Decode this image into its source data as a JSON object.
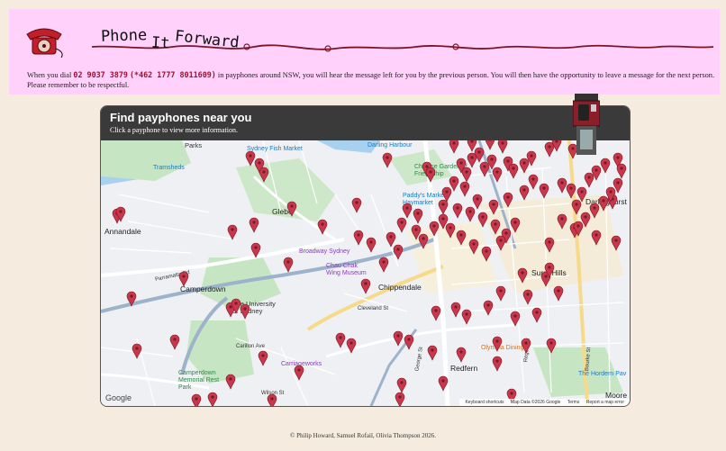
{
  "header": {
    "title_words": [
      "Phone",
      "It",
      "Forward"
    ],
    "intro_before": "When you dial ",
    "number_primary": "02 9037 3879",
    "number_alt": "(*462 1777 8011609)",
    "intro_after": " in payphones around NSW, you will hear the message left for you by the previous person. You will then have the opportunity to leave a message for the next person. Please remember to be respectful.",
    "logo_icon": "rotary-phone-icon"
  },
  "map": {
    "title": "Find payphones near you",
    "subtitle": "Click a payphone to view more information.",
    "header_image_icon": "payphone-icon",
    "marker_color": "#c8374b",
    "labels": {
      "parks": "Parks",
      "fish_market": "Sydney Fish Market",
      "darling_harbour": "Darling Harbour",
      "chinese_garden": "Chinese Garden of Friendship",
      "tramsheds": "Tramsheds",
      "glebe": "Glebe",
      "paddys": "Paddy's Markets Haymarket",
      "darlinghurst": "Darlinghurst",
      "annandale": "Annandale",
      "broadway": "Broadway Sydney",
      "chau_chak": "Chau Chak Wing Museum",
      "surry_hills": "Surry Hills",
      "camperdown": "Camperdown",
      "chippendale": "Chippendale",
      "uni_sydney": "The University of Sydney",
      "olympia": "Olympia Dining",
      "carriageworks": "Carriageworks",
      "redfern": "Redfern",
      "camperdown_park": "Camperdown Memorial Rest Park",
      "hordern": "The Hordern Pav",
      "moore": "Moore P",
      "cleveland": "Cleveland St",
      "parramatta": "Parramatta Rd",
      "wilson": "Wilson St",
      "carillon": "Carillon Ave",
      "george": "George St",
      "bourke": "Bourke St",
      "regent": "Regent St"
    },
    "google_label": "Google",
    "attribution": [
      "Keyboard shortcuts",
      "Map Data ©2026 Google",
      "Terms",
      "Report a map error"
    ]
  },
  "footer": {
    "text": "© Philip Howard, Samuel Rofail, Olivia Thompson 2026."
  }
}
